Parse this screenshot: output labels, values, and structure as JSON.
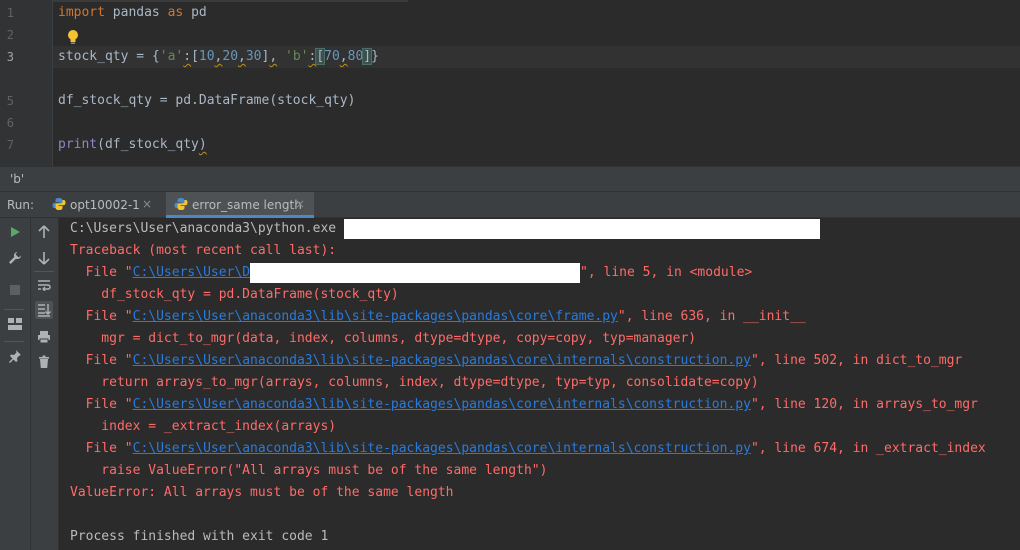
{
  "editor": {
    "line_numbers": [
      "1",
      "2",
      "3",
      "5",
      "6",
      "7"
    ],
    "lines": {
      "l1_kw1": "import",
      "l1_mid": " pandas ",
      "l1_kw2": "as",
      "l1_end": " pd",
      "l3_a": "stock_qty = {",
      "l3_s1": "'a'",
      "l3_colon1": ":",
      "l3_lb1": "[",
      "l3_n1": "10",
      "l3_c1": ",",
      "l3_n2": "20",
      "l3_c2": ",",
      "l3_n3": "30",
      "l3_rb1": "]",
      "l3_c3": ",",
      "l3_sp": " ",
      "l3_s2": "'b'",
      "l3_colon2": ":",
      "l3_lb2": "[",
      "l3_n4": "70",
      "l3_c4": ",",
      "l3_n5": "80",
      "l3_rb2": "]",
      "l3_end": "}",
      "l5": "df_stock_qty = pd.DataFrame(stock_qty)",
      "l7_fn": "print",
      "l7_open": "(df_stock_qty",
      "l7_close": ")"
    },
    "lightbulb_icon": "lightbulb-icon"
  },
  "breadcrumb": {
    "text": "'b'"
  },
  "run_panel": {
    "label": "Run:",
    "tabs": [
      {
        "label": "opt10002-1",
        "close": "×",
        "icon": "python-icon"
      },
      {
        "label": "error_same length",
        "close": "×",
        "icon": "python-icon"
      }
    ]
  },
  "toolbar": {
    "left": [
      "rerun-icon",
      "wrench-icon",
      "stop-icon",
      "layout-icon",
      "pin-icon"
    ],
    "right": [
      "up-arrow-icon",
      "down-arrow-icon",
      "soft-wrap-icon",
      "scroll-to-end-icon",
      "print-icon",
      "trash-icon"
    ]
  },
  "console": {
    "l1": "C:\\Users\\User\\anaconda3\\python.exe ",
    "l2": "Traceback (most recent call last):",
    "l3_pre": "  File \"",
    "l3_link": "C:\\Users\\User\\D",
    "l3_post": "\", line 5, in <module>",
    "l4": "    df_stock_qty = pd.DataFrame(stock_qty)",
    "l5_pre": "  File \"",
    "l5_link": "C:\\Users\\User\\anaconda3\\lib\\site-packages\\pandas\\core\\frame.py",
    "l5_post": "\", line 636, in __init__",
    "l6": "    mgr = dict_to_mgr(data, index, columns, dtype=dtype, copy=copy, typ=manager)",
    "l7_pre": "  File \"",
    "l7_link": "C:\\Users\\User\\anaconda3\\lib\\site-packages\\pandas\\core\\internals\\construction.py",
    "l7_post": "\", line 502, in dict_to_mgr",
    "l8": "    return arrays_to_mgr(arrays, columns, index, dtype=dtype, typ=typ, consolidate=copy)",
    "l9_pre": "  File \"",
    "l9_link": "C:\\Users\\User\\anaconda3\\lib\\site-packages\\pandas\\core\\internals\\construction.py",
    "l9_post": "\", line 120, in arrays_to_mgr",
    "l10": "    index = _extract_index(arrays)",
    "l11_pre": "  File \"",
    "l11_link": "C:\\Users\\User\\anaconda3\\lib\\site-packages\\pandas\\core\\internals\\construction.py",
    "l11_post": "\", line 674, in _extract_index",
    "l12": "    raise ValueError(\"All arrays must be of the same length\")",
    "l13": "ValueError: All arrays must be of the same length",
    "l15": "Process finished with exit code 1"
  },
  "colors": {
    "error": "#ff6b68",
    "link": "#287bde",
    "keyword": "#cc7832",
    "string": "#6a8759",
    "number": "#6897bb",
    "accent": "#4a88c7"
  }
}
